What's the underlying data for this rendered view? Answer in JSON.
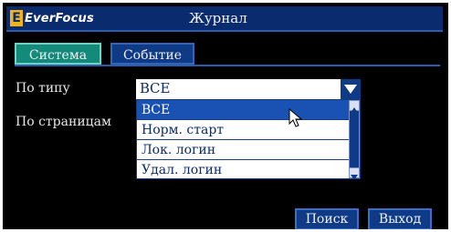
{
  "header": {
    "logo_text": "EverFocus",
    "logo_mark": "E",
    "title": "Журнал"
  },
  "tabs": [
    {
      "label": "Система",
      "active": true
    },
    {
      "label": "Событие",
      "active": false
    }
  ],
  "form": {
    "type_label": "По типу",
    "pages_label": "По страницам",
    "type_select": {
      "value": "ВСЕ",
      "options": [
        "ВСЕ",
        "Норм. старт",
        "Лок. логин",
        "Удал. логин"
      ],
      "highlighted_index": 0
    }
  },
  "buttons": {
    "search": "Поиск",
    "exit": "Выход"
  },
  "icons": {
    "dropdown_arrow": "chevron-down-icon",
    "cursor": "mouse-pointer-icon",
    "scroll_up": "scroll-up-icon",
    "scroll_down": "scroll-down-icon"
  },
  "colors": {
    "titlebar": "#0a2b6e",
    "tab_active": "#138a7a",
    "tab_inactive": "#0f3a86",
    "selection": "#1a52b4",
    "logo_accent": "#f1b319"
  }
}
